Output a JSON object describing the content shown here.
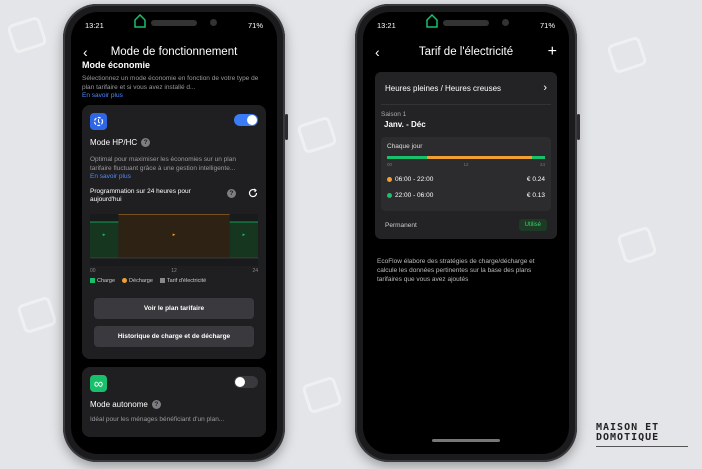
{
  "left_phone": {
    "status": {
      "time": "13:21",
      "battery": "71%"
    },
    "title": "Mode de fonctionnement",
    "section_heading": "Mode économie",
    "section_description": "Sélectionnez un mode économie en fonction de votre type de plan tarifaire et si vous avez installé d...",
    "learn_more": "En savoir plus",
    "hp_hc": {
      "title": "Mode HP/HC",
      "enabled": true,
      "description": "Optimal pour maximiser les économies sur un plan tarifaire fluctuant grâce à une gestion intelligente...",
      "learn_more": "En savoir plus",
      "schedule_label": "Programmation sur 24 heures pour aujourd'hui",
      "axis_ticks": [
        "00",
        "12",
        "24"
      ],
      "legend": [
        {
          "label": "Charge",
          "color": "#19c06b"
        },
        {
          "label": "Décharge",
          "color": "#f0a030"
        },
        {
          "label": "Tarif d'électricité",
          "color": "#888888"
        }
      ],
      "buttons": {
        "view_plan": "Voir le plan tarifaire",
        "history": "Historique de charge et de décharge"
      }
    },
    "autonomous": {
      "title": "Mode autonome",
      "enabled": false,
      "description": "Idéal pour les ménages bénéficiant d'un plan..."
    }
  },
  "right_phone": {
    "status": {
      "time": "13:21",
      "battery": "71%"
    },
    "title": "Tarif de l'électricité",
    "plan_name": "Heures pleines / Heures creuses",
    "season_label": "Saison 1",
    "season_range": "Janv. - Déc",
    "frequency": "Chaque jour",
    "axis_ticks": [
      "00",
      "12",
      "24"
    ],
    "rates": [
      {
        "range": "06:00 - 22:00",
        "price": "€ 0.24",
        "color": "#f0a030"
      },
      {
        "range": "22:00 - 06:00",
        "price": "€ 0.13",
        "color": "#19c06b"
      }
    ],
    "permanence": "Permanent",
    "status_badge": "Utilisé",
    "footer_text": "EcoFlow élabore des stratégies de charge/décharge et calcule les données pertinentes sur la base des plans tarifaires que vous avez ajoutés"
  },
  "logo": {
    "line1": "MAISON ET",
    "line2": "DOMOTIQUE"
  }
}
